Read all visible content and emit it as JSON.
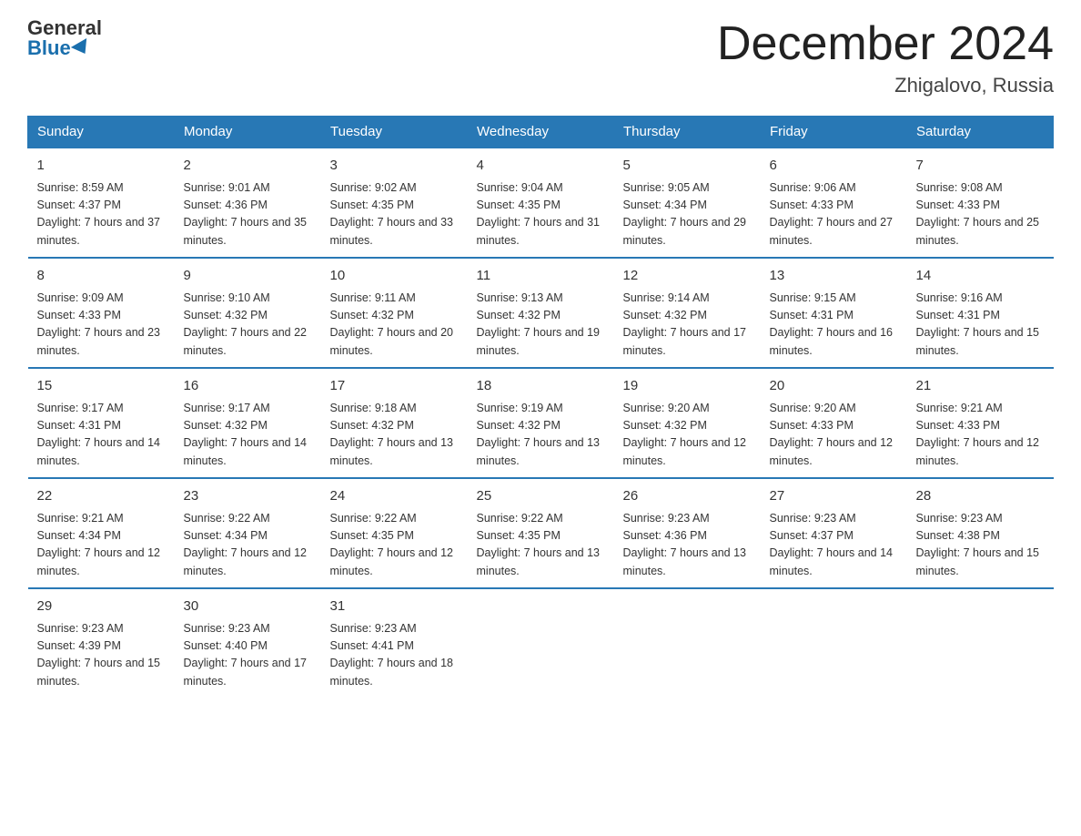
{
  "logo": {
    "general": "General",
    "blue": "Blue"
  },
  "title": "December 2024",
  "location": "Zhigalovo, Russia",
  "weekdays": [
    "Sunday",
    "Monday",
    "Tuesday",
    "Wednesday",
    "Thursday",
    "Friday",
    "Saturday"
  ],
  "weeks": [
    [
      {
        "day": "1",
        "sunrise": "8:59 AM",
        "sunset": "4:37 PM",
        "daylight": "7 hours and 37 minutes."
      },
      {
        "day": "2",
        "sunrise": "9:01 AM",
        "sunset": "4:36 PM",
        "daylight": "7 hours and 35 minutes."
      },
      {
        "day": "3",
        "sunrise": "9:02 AM",
        "sunset": "4:35 PM",
        "daylight": "7 hours and 33 minutes."
      },
      {
        "day": "4",
        "sunrise": "9:04 AM",
        "sunset": "4:35 PM",
        "daylight": "7 hours and 31 minutes."
      },
      {
        "day": "5",
        "sunrise": "9:05 AM",
        "sunset": "4:34 PM",
        "daylight": "7 hours and 29 minutes."
      },
      {
        "day": "6",
        "sunrise": "9:06 AM",
        "sunset": "4:33 PM",
        "daylight": "7 hours and 27 minutes."
      },
      {
        "day": "7",
        "sunrise": "9:08 AM",
        "sunset": "4:33 PM",
        "daylight": "7 hours and 25 minutes."
      }
    ],
    [
      {
        "day": "8",
        "sunrise": "9:09 AM",
        "sunset": "4:33 PM",
        "daylight": "7 hours and 23 minutes."
      },
      {
        "day": "9",
        "sunrise": "9:10 AM",
        "sunset": "4:32 PM",
        "daylight": "7 hours and 22 minutes."
      },
      {
        "day": "10",
        "sunrise": "9:11 AM",
        "sunset": "4:32 PM",
        "daylight": "7 hours and 20 minutes."
      },
      {
        "day": "11",
        "sunrise": "9:13 AM",
        "sunset": "4:32 PM",
        "daylight": "7 hours and 19 minutes."
      },
      {
        "day": "12",
        "sunrise": "9:14 AM",
        "sunset": "4:32 PM",
        "daylight": "7 hours and 17 minutes."
      },
      {
        "day": "13",
        "sunrise": "9:15 AM",
        "sunset": "4:31 PM",
        "daylight": "7 hours and 16 minutes."
      },
      {
        "day": "14",
        "sunrise": "9:16 AM",
        "sunset": "4:31 PM",
        "daylight": "7 hours and 15 minutes."
      }
    ],
    [
      {
        "day": "15",
        "sunrise": "9:17 AM",
        "sunset": "4:31 PM",
        "daylight": "7 hours and 14 minutes."
      },
      {
        "day": "16",
        "sunrise": "9:17 AM",
        "sunset": "4:32 PM",
        "daylight": "7 hours and 14 minutes."
      },
      {
        "day": "17",
        "sunrise": "9:18 AM",
        "sunset": "4:32 PM",
        "daylight": "7 hours and 13 minutes."
      },
      {
        "day": "18",
        "sunrise": "9:19 AM",
        "sunset": "4:32 PM",
        "daylight": "7 hours and 13 minutes."
      },
      {
        "day": "19",
        "sunrise": "9:20 AM",
        "sunset": "4:32 PM",
        "daylight": "7 hours and 12 minutes."
      },
      {
        "day": "20",
        "sunrise": "9:20 AM",
        "sunset": "4:33 PM",
        "daylight": "7 hours and 12 minutes."
      },
      {
        "day": "21",
        "sunrise": "9:21 AM",
        "sunset": "4:33 PM",
        "daylight": "7 hours and 12 minutes."
      }
    ],
    [
      {
        "day": "22",
        "sunrise": "9:21 AM",
        "sunset": "4:34 PM",
        "daylight": "7 hours and 12 minutes."
      },
      {
        "day": "23",
        "sunrise": "9:22 AM",
        "sunset": "4:34 PM",
        "daylight": "7 hours and 12 minutes."
      },
      {
        "day": "24",
        "sunrise": "9:22 AM",
        "sunset": "4:35 PM",
        "daylight": "7 hours and 12 minutes."
      },
      {
        "day": "25",
        "sunrise": "9:22 AM",
        "sunset": "4:35 PM",
        "daylight": "7 hours and 13 minutes."
      },
      {
        "day": "26",
        "sunrise": "9:23 AM",
        "sunset": "4:36 PM",
        "daylight": "7 hours and 13 minutes."
      },
      {
        "day": "27",
        "sunrise": "9:23 AM",
        "sunset": "4:37 PM",
        "daylight": "7 hours and 14 minutes."
      },
      {
        "day": "28",
        "sunrise": "9:23 AM",
        "sunset": "4:38 PM",
        "daylight": "7 hours and 15 minutes."
      }
    ],
    [
      {
        "day": "29",
        "sunrise": "9:23 AM",
        "sunset": "4:39 PM",
        "daylight": "7 hours and 15 minutes."
      },
      {
        "day": "30",
        "sunrise": "9:23 AM",
        "sunset": "4:40 PM",
        "daylight": "7 hours and 17 minutes."
      },
      {
        "day": "31",
        "sunrise": "9:23 AM",
        "sunset": "4:41 PM",
        "daylight": "7 hours and 18 minutes."
      },
      null,
      null,
      null,
      null
    ]
  ]
}
